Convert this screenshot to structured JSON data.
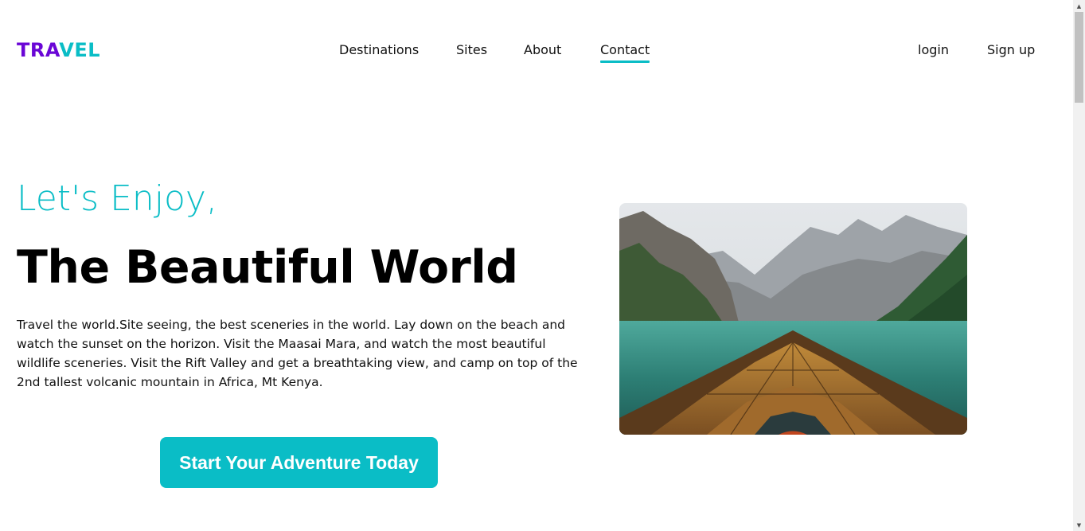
{
  "header": {
    "logo": {
      "part1": "TRA",
      "part2": "VEL",
      "color1": "#6a06d6",
      "color2": "#0abdc6"
    },
    "nav": [
      {
        "label": "Destinations",
        "active": false
      },
      {
        "label": "Sites",
        "active": false
      },
      {
        "label": "About",
        "active": false
      },
      {
        "label": "Contact",
        "active": true
      }
    ],
    "auth": {
      "login": "login",
      "signup": "Sign up"
    }
  },
  "hero": {
    "kicker": "Let's Enjoy,",
    "title": "The Beautiful World",
    "description": "Travel the world.Site seeing, the best sceneries in the world. Lay down on the beach and watch the sunset on the horizon. Visit the Maasai Mara, and watch the most beautiful wildlife sceneries. Visit the Rift Valley and get a breathtaking view, and camp on top of the 2nd tallest volcanic mountain in Africa, Mt Kenya.",
    "cta": "Start Your Adventure Today",
    "image": "mountain-lake-boat-photo"
  },
  "colors": {
    "accent": "#0abdc6",
    "brand": "#6a06d6"
  }
}
